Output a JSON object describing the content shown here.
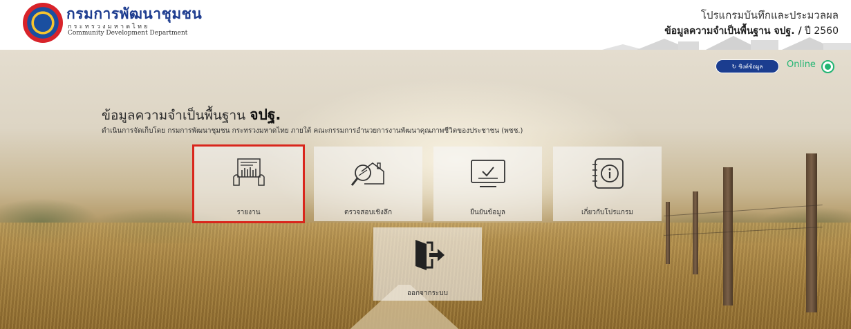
{
  "header": {
    "org_name_thai": "กรมการพัฒนาชุมชน",
    "org_ministry_thai": "กระทรวงมหาดไทย",
    "org_name_english": "Community Development Department",
    "program_title": "โปรแกรมบันทึกและประมวลผล",
    "program_subtitle_prefix": "ข้อมูลความจำเป็นพื้นฐาน จปฐ. /",
    "program_subtitle_year": "ปี 2560"
  },
  "status": {
    "sync_label": "ซิงค์ข้อมูล",
    "sync_icon": "refresh-icon",
    "online_label": "Online",
    "online_color": "#22b573"
  },
  "main": {
    "title_prefix": "ข้อมูลความจำเป็นพื้นฐาน",
    "title_strong": "จปฐ.",
    "description": "ดำเนินการจัดเก็บโดย กรมการพัฒนาชุมชน กระทรวงมหาดไทย ภายใต้ คณะกรรมการอำนวยการงานพัฒนาคุณภาพชีวิตของประชาชน (พชช.)"
  },
  "menu": {
    "report_label": "รายงาน",
    "report_icon": "report-document-icon",
    "inspect_label": "ตรวจสอบเชิงลึก",
    "inspect_icon": "magnifier-house-icon",
    "confirm_label": "ยืนยันข้อมูล",
    "confirm_icon": "monitor-check-icon",
    "about_label": "เกี่ยวกับโปรแกรม",
    "about_icon": "info-notebook-icon",
    "logout_label": "ออกจากระบบ",
    "logout_icon": "exit-door-icon",
    "selected_color": "#d9261c"
  }
}
